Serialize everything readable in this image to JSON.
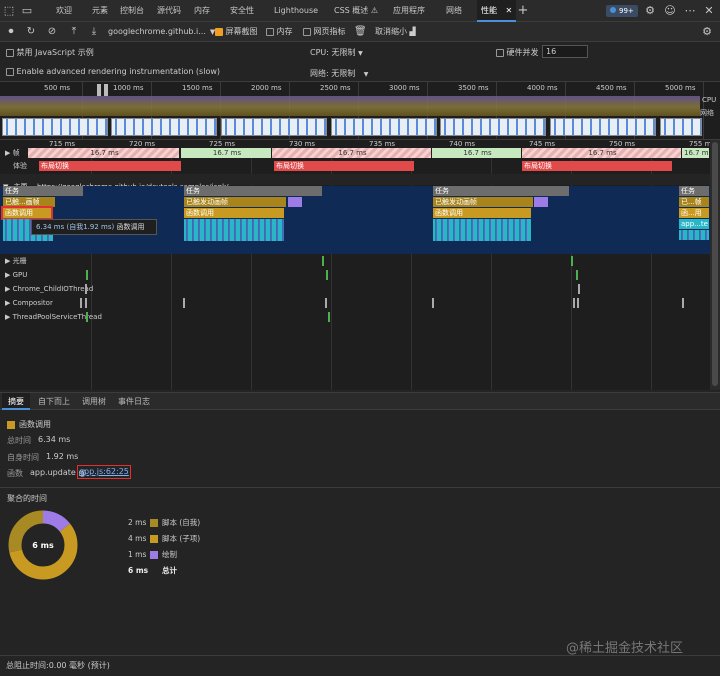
{
  "tabs": [
    {
      "label": "欢迎"
    },
    {
      "label": "元素"
    },
    {
      "label": "控制台"
    },
    {
      "label": "源代码"
    },
    {
      "label": "内存"
    },
    {
      "label": "安全性"
    },
    {
      "label": "Lighthouse"
    },
    {
      "label": "CSS 概述 ⚠"
    },
    {
      "label": "应用程序"
    },
    {
      "label": "网络"
    },
    {
      "label": "性能"
    }
  ],
  "issues_badge": "99+",
  "toolbar": {
    "url": "googlechrome.github.i...",
    "screenshots": "屏幕截图",
    "memory": "内存",
    "web_vitals": "网页指标",
    "shrink": "取消缩小"
  },
  "options": {
    "disable_js": "禁用 JavaScript 示例",
    "advanced": "Enable advanced rendering instrumentation (slow)",
    "cpu_label": "CPU:",
    "cpu_value": "无限制",
    "net_label": "网络:",
    "net_value": "无限制",
    "hw_label": "硬件并发",
    "hw_value": "16"
  },
  "overview": {
    "ticks": [
      "500 ms",
      "1000 ms",
      "1500 ms",
      "2000 ms",
      "2500 ms",
      "3000 ms",
      "3500 ms",
      "4000 ms",
      "4500 ms",
      "5000 ms"
    ],
    "cpu_label": "CPU",
    "net_label": "网络"
  },
  "timeline": {
    "ticks": [
      "715 ms",
      "720 ms",
      "725 ms",
      "730 ms",
      "735 ms",
      "740 ms",
      "745 ms",
      "750 ms",
      "755 ms"
    ],
    "frames_label": "帧",
    "frame_values": [
      "16.7 ms",
      "16.7 ms",
      "16.7 ms",
      "16.7 ms",
      "16.7 ms",
      "16.7 ms",
      "16.7 ms",
      "16.7 ms",
      "16.7 ms"
    ],
    "experience_label": "体验",
    "layout_shift": "布局切换",
    "main_label": "主要 -- https://googlechrome.github.io/devtools-samples/jank/",
    "task": "任务",
    "anim_frame": "已触发动画帧",
    "anim_frame_short1": "已触...画帧",
    "anim_frame_short2": "已...帧",
    "func_call": "函数调用",
    "func_short": "函...用",
    "app_short": "app...te",
    "tooltip_time": "6.34 ms (自我1.92 ms)",
    "tooltip_name": "函数调用",
    "tracks": [
      "光栅",
      "GPU",
      "Chrome_ChildIOThread",
      "Compositor",
      "ThreadPoolServiceThread"
    ]
  },
  "details": {
    "tabs": [
      "摘要",
      "自下而上",
      "调用树",
      "事件日志"
    ],
    "title": "函数调用",
    "total_label": "总时间",
    "total_value": "6.34 ms",
    "self_label": "自身时间",
    "self_value": "1.92 ms",
    "func_label": "函数",
    "func_value": "app.update @",
    "func_link": "app.js:62:25",
    "agg_title": "聚合的时间",
    "donut_center": "6 ms",
    "legend": [
      {
        "value": "2 ms",
        "label": "脚本 (自我)",
        "color": "#a78a24"
      },
      {
        "value": "4 ms",
        "label": "脚本 (子项)",
        "color": "#c99a22"
      },
      {
        "value": "1 ms",
        "label": "绘制",
        "color": "#9e7ce8"
      }
    ],
    "total_row_value": "6 ms",
    "total_row_label": "总计"
  },
  "watermark": "@稀土掘金技术社区",
  "status": "总阻止时间:0.00 毫秒 (预计)",
  "colors": {
    "script": "#c99a22",
    "paint": "#9e7ce8",
    "task": "#6d6d6d",
    "layout_shift": "#e04a4a",
    "selection": "#e03030",
    "link": "#7fb0ff"
  }
}
